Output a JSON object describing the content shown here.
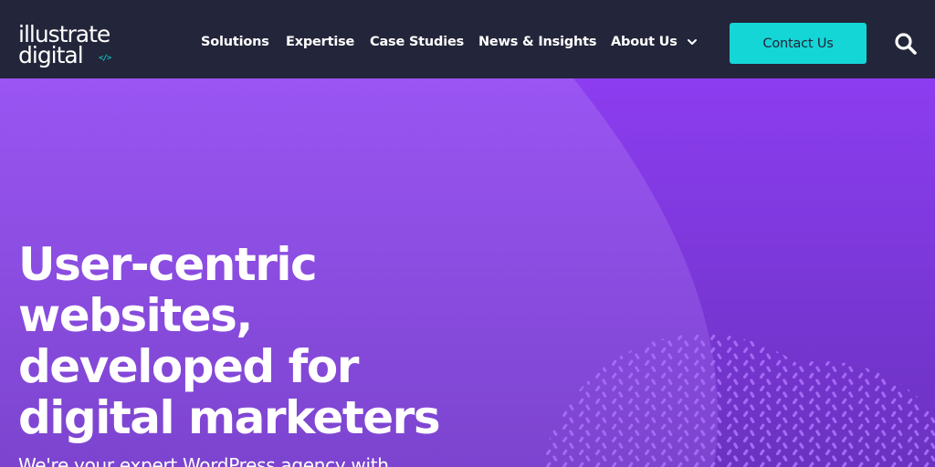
{
  "header": {
    "logo": {
      "line1": "illustrate",
      "line2": "digital",
      "mark": "</>"
    },
    "nav": [
      {
        "label": "Solutions"
      },
      {
        "label": "Expertise"
      },
      {
        "label": "Case Studies"
      },
      {
        "label": "News & Insights"
      },
      {
        "label": "About Us",
        "has_dropdown": true
      }
    ],
    "cta_label": "Contact Us",
    "search_icon": "search-icon",
    "dropdown_icon": "chevron-down-icon"
  },
  "hero": {
    "headline": [
      "User-centric",
      "websites,",
      "developed for",
      "digital marketers"
    ],
    "subtext": "We're your expert WordPress agency with"
  },
  "colors": {
    "header_bg": "#23253a",
    "accent": "#14d6d6",
    "hero_purple": "#7b3fd6"
  }
}
